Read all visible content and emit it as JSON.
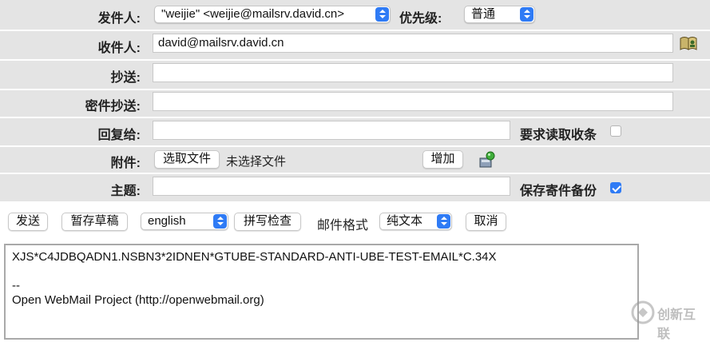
{
  "from": {
    "label": "发件人:",
    "value": "\"weijie\" <weijie@mailsrv.david.cn>"
  },
  "priority": {
    "label": "优先级:",
    "value": "普通"
  },
  "to": {
    "label": "收件人:",
    "value": "david@mailsrv.david.cn",
    "icon": "address-book-icon"
  },
  "cc": {
    "label": "抄送:",
    "value": ""
  },
  "bcc": {
    "label": "密件抄送:",
    "value": ""
  },
  "reply_to": {
    "label": "回复给:",
    "value": ""
  },
  "read_receipt": {
    "label": "要求读取收条",
    "checked": false
  },
  "attachment": {
    "label": "附件:",
    "choose_button": "选取文件",
    "no_file": "未选择文件",
    "add_button": "增加",
    "icon": "attachment-icon"
  },
  "subject": {
    "label": "主题:",
    "value": ""
  },
  "save_copy": {
    "label": "保存寄件备份",
    "checked": true
  },
  "toolbar": {
    "send": "发送",
    "save_draft": "暂存草稿",
    "language": "english",
    "spellcheck": "拼写检查",
    "format_label": "邮件格式",
    "format": "纯文本",
    "cancel": "取消"
  },
  "message_body": {
    "lines": [
      "XJS*C4JDBQADN1.NSBN3*2IDNEN*GTUBE-STANDARD-ANTI-UBE-TEST-EMAIL*C.34X",
      "",
      "--",
      "Open WebMail Project (http://openwebmail.org)"
    ]
  },
  "watermark": {
    "text": "创新互联",
    "icon": "logo-icon"
  },
  "colors": {
    "row_bg": "#e4e4e4",
    "row_border": "#ffffff",
    "accent": "#2f7bf5"
  }
}
